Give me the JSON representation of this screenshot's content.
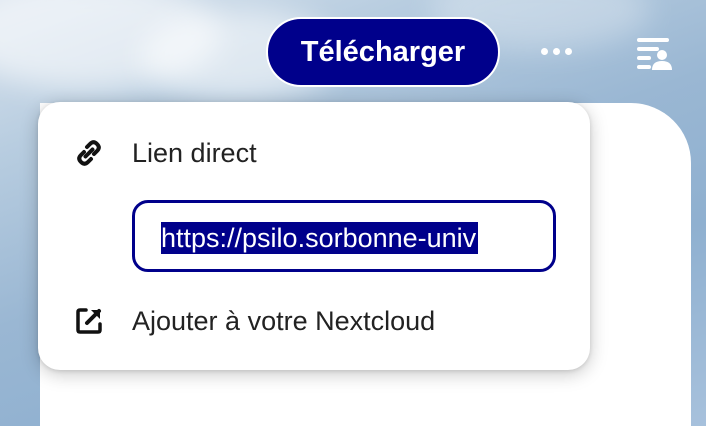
{
  "header": {
    "download_label": "Télécharger",
    "more_icon": "ellipsis-icon",
    "sidebar_icon": "sidebar-toggle-icon"
  },
  "share_menu": {
    "items": [
      {
        "label": "Lien direct",
        "icon": "link-icon"
      },
      {
        "label": "Ajouter à votre Nextcloud",
        "icon": "external-link-icon"
      }
    ],
    "direct_link_value": "https://psilo.sorbonne-univ"
  },
  "colors": {
    "accent": "#00008b",
    "menu_background": "#ffffff",
    "text": "#222222"
  }
}
